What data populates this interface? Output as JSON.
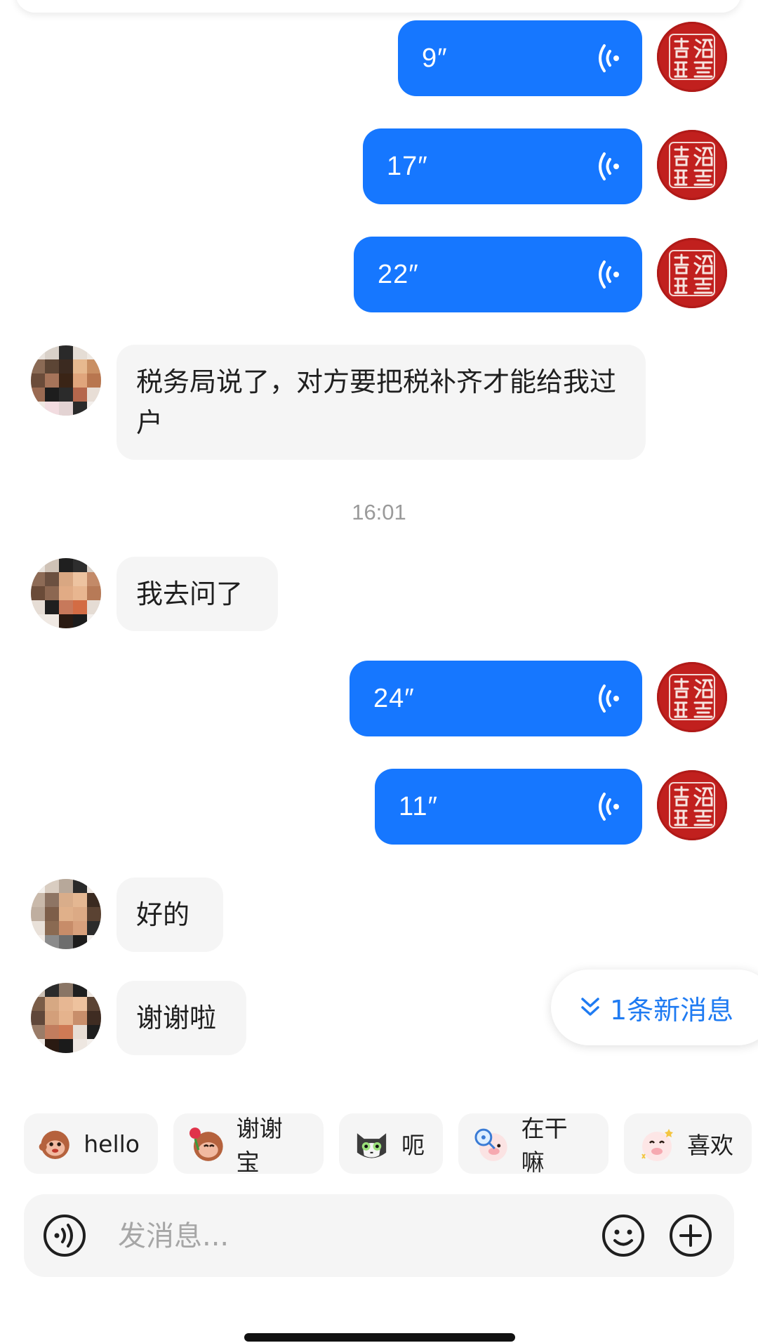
{
  "voice_messages_before": [
    {
      "duration": "9″"
    },
    {
      "duration": "17″"
    },
    {
      "duration": "22″"
    }
  ],
  "incoming_1": {
    "text": "税务局说了，对方要把税补齐才能给我过户"
  },
  "timestamp": "16:01",
  "incoming_2": {
    "text": "我去问了"
  },
  "voice_messages_after": [
    {
      "duration": "24″"
    },
    {
      "duration": "11″"
    }
  ],
  "incoming_3": {
    "text": "好的"
  },
  "incoming_4": {
    "text": "谢谢啦"
  },
  "new_messages_pill": {
    "label": "1条新消息"
  },
  "quick_replies": [
    {
      "label": "hello",
      "icon": "monkey-wave-sticker-icon"
    },
    {
      "label": "谢谢宝",
      "icon": "monkey-rose-sticker-icon"
    },
    {
      "label": "呃",
      "icon": "gray-cat-sticker-icon"
    },
    {
      "label": "在干嘛",
      "icon": "pig-magnifier-sticker-icon"
    },
    {
      "label": "喜欢",
      "icon": "pig-heart-sticker-icon"
    }
  ],
  "input": {
    "placeholder": "发消息..."
  },
  "icons": {
    "voice_toggle": "voice-wave-icon",
    "emoji": "smiley-icon",
    "more": "plus-circle-icon",
    "voice_bubble": "sound-wave-icon",
    "avatar_self": "seal-stamp-avatar"
  },
  "colors": {
    "voice_bubble": "#1677ff",
    "incoming_bubble": "#f5f5f5",
    "seal_red": "#c1201e",
    "accent_blue": "#1f7bf2"
  }
}
